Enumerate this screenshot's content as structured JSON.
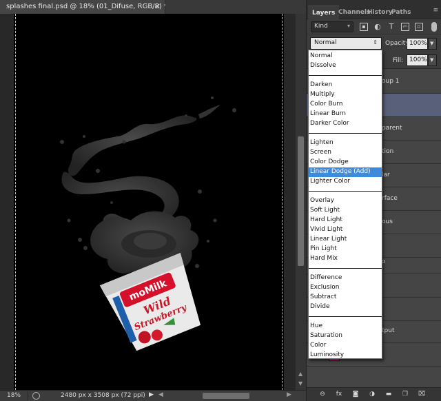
{
  "document": {
    "tab_title": "splashes final.psd @ 18% (01_Difuse, RGB/8) *",
    "close_symbol": "✕"
  },
  "status_bar": {
    "zoom": "18%",
    "doc_info": "2480 px x 3508 px (72 ppi)"
  },
  "canvas_art": {
    "cup_brand": "moMilk",
    "cup_flavor_line1": "Wild",
    "cup_flavor_line2": "Strawberry"
  },
  "panel": {
    "tabs": [
      "Layers",
      "Channels",
      "History",
      "Paths"
    ],
    "filter_kind": "Kind",
    "blend_mode": "Normal",
    "opacity_label": "Opacity:",
    "opacity_value": "100%",
    "fill_label": "Fill:",
    "fill_value": "100%",
    "layer_names_visible": [
      "oup 1",
      "",
      "parent",
      "tion",
      "lar",
      "rface",
      "ous",
      "",
      "o",
      "",
      "",
      "tput",
      ""
    ],
    "swatch_color": "#e0238b"
  },
  "blend_menu": {
    "groups": [
      [
        "Normal",
        "Dissolve"
      ],
      [
        "Darken",
        "Multiply",
        "Color Burn",
        "Linear Burn",
        "Darker Color"
      ],
      [
        "Lighten",
        "Screen",
        "Color Dodge",
        "Linear Dodge (Add)",
        "Lighter Color"
      ],
      [
        "Overlay",
        "Soft Light",
        "Hard Light",
        "Vivid Light",
        "Linear Light",
        "Pin Light",
        "Hard Mix"
      ],
      [
        "Difference",
        "Exclusion",
        "Subtract",
        "Divide"
      ],
      [
        "Hue",
        "Saturation",
        "Color",
        "Luminosity"
      ]
    ],
    "highlighted": "Linear Dodge (Add)",
    "highlight_color": "#3d8bdc"
  },
  "colors": {
    "canvas_bg": "#000000",
    "panel_bg": "#3c3c3c",
    "selected_layer": "#59617a"
  }
}
